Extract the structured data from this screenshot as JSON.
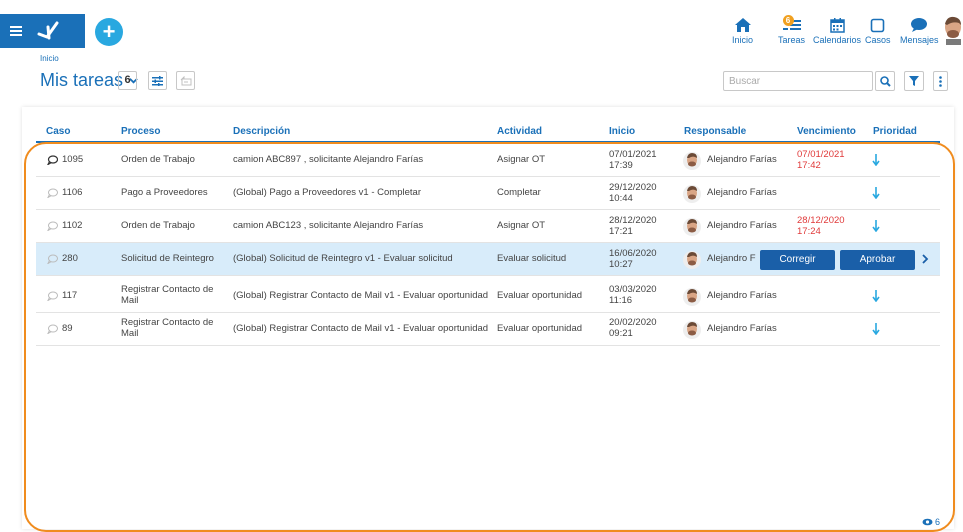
{
  "header": {
    "nav": [
      {
        "label": "Inicio",
        "icon": "home-icon"
      },
      {
        "label": "Tareas",
        "icon": "tasks-icon",
        "badge": "6"
      },
      {
        "label": "Calendarios",
        "icon": "calendar-icon"
      },
      {
        "label": "Casos",
        "icon": "cases-icon"
      },
      {
        "label": "Mensajes",
        "icon": "messages-icon"
      }
    ]
  },
  "breadcrumb": "Inicio",
  "page": {
    "title": "Mis tareas",
    "count": "6"
  },
  "search": {
    "placeholder": "Buscar",
    "value": ""
  },
  "table": {
    "columns": [
      "Caso",
      "Proceso",
      "Descripción",
      "Actividad",
      "Inicio",
      "Responsable",
      "Vencimiento",
      "Prioridad"
    ],
    "rows": [
      {
        "case": "1095",
        "process": "Orden de Trabajo",
        "description": "camion ABC897 , solicitante Alejandro Farías",
        "activity": "Asignar OT",
        "start_date": "07/01/2021",
        "start_time": "17:39",
        "responsible": "Alejandro Farías",
        "due_date": "07/01/2021",
        "due_time": "17:42"
      },
      {
        "case": "1106",
        "process": "Pago a Proveedores",
        "description": "(Global) Pago a Proveedores v1 - Completar",
        "activity": "Completar",
        "start_date": "29/12/2020",
        "start_time": "10:44",
        "responsible": "Alejandro Farías",
        "due_date": "",
        "due_time": ""
      },
      {
        "case": "1102",
        "process": "Orden de Trabajo",
        "description": "camion ABC123 , solicitante Alejandro Farías",
        "activity": "Asignar OT",
        "start_date": "28/12/2020",
        "start_time": "17:21",
        "responsible": "Alejandro Farías",
        "due_date": "28/12/2020",
        "due_time": "17:24"
      },
      {
        "case": "280",
        "process": "Solicitud de Reintegro",
        "description": "(Global) Solicitud de Reintegro v1 - Evaluar solicitud",
        "activity": "Evaluar solicitud",
        "start_date": "16/06/2020",
        "start_time": "10:27",
        "responsible": "Alejandro F",
        "due_date": "",
        "due_time": "",
        "actions": [
          "Corregir",
          "Aprobar"
        ]
      },
      {
        "case": "117",
        "process": "Registrar Contacto de Mail",
        "description": "(Global) Registrar Contacto de Mail v1 - Evaluar oportunidad",
        "activity": "Evaluar oportunidad",
        "start_date": "03/03/2020",
        "start_time": "11:16",
        "responsible": "Alejandro Farías",
        "due_date": "",
        "due_time": ""
      },
      {
        "case": "89",
        "process": "Registrar Contacto de Mail",
        "description": "(Global) Registrar Contacto de Mail v1 - Evaluar oportunidad",
        "activity": "Evaluar oportunidad",
        "start_date": "20/02/2020",
        "start_time": "09:21",
        "responsible": "Alejandro Farías",
        "due_date": "",
        "due_time": ""
      }
    ]
  },
  "footer": {
    "viewers_count": "6"
  },
  "colors": {
    "primary": "#1a70b8",
    "accent": "#29a8e0",
    "highlight": "#f08c1e",
    "due": "#e03a3a",
    "selected_row": "#d8ecfa"
  }
}
